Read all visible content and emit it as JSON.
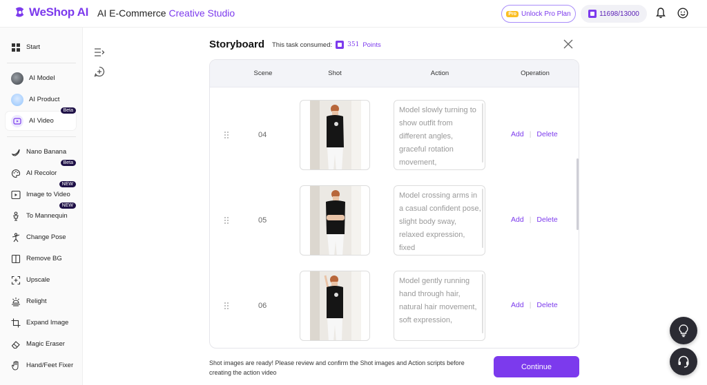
{
  "header": {
    "logo_text": "WeShop AI",
    "app_title_prefix": "AI E-Commerce",
    "app_title_accent": "Creative Studio",
    "pro_tag": "Pro",
    "unlock_label": "Unlock Pro Plan",
    "points": "11698/13000"
  },
  "sidebar": {
    "items": [
      {
        "label": "Start",
        "icon": "grid-icon"
      },
      {
        "label": "AI Model",
        "icon": "model-avatar"
      },
      {
        "label": "AI Product",
        "icon": "product-avatar"
      },
      {
        "label": "AI Video",
        "icon": "video-icon",
        "badge": "Beta",
        "active": true
      },
      {
        "label": "Nano Banana",
        "icon": "banana-icon"
      },
      {
        "label": "AI Recolor",
        "icon": "palette-icon",
        "badge": "Beta"
      },
      {
        "label": "Image to Video",
        "icon": "image-video-icon",
        "badge": "NEW"
      },
      {
        "label": "To Mannequin",
        "icon": "mannequin-icon",
        "badge": "NEW"
      },
      {
        "label": "Change Pose",
        "icon": "pose-icon"
      },
      {
        "label": "Remove BG",
        "icon": "remove-bg-icon"
      },
      {
        "label": "Upscale",
        "icon": "upscale-icon"
      },
      {
        "label": "Relight",
        "icon": "relight-icon"
      },
      {
        "label": "Expand Image",
        "icon": "expand-icon"
      },
      {
        "label": "Magic Eraser",
        "icon": "eraser-icon"
      },
      {
        "label": "Hand/Feet Fixer",
        "icon": "hand-icon"
      }
    ]
  },
  "storyboard": {
    "title": "Storyboard",
    "consumed_label": "This task consumed:",
    "points_value": "351",
    "points_label": "Points",
    "columns": [
      "Scene",
      "Shot",
      "Action",
      "Operation"
    ],
    "rows": [
      {
        "scene": "04",
        "action": "Model slowly turning to show outfit from different angles, graceful rotation movement,",
        "add": "Add",
        "delete": "Delete"
      },
      {
        "scene": "05",
        "action": "Model crossing arms in a casual confident pose, slight body sway, relaxed expression, fixed",
        "add": "Add",
        "delete": "Delete"
      },
      {
        "scene": "06",
        "action": "Model gently running hand through hair, natural hair movement, soft expression,",
        "add": "Add",
        "delete": "Delete"
      }
    ],
    "notice": "Shot images are ready! Please review and confirm the Shot images and Action scripts before creating the action video",
    "continue_label": "Continue"
  },
  "colors": {
    "accent": "#7c3aed",
    "badge_bg": "#1f1147",
    "pro_tag": "#fbbf24"
  }
}
